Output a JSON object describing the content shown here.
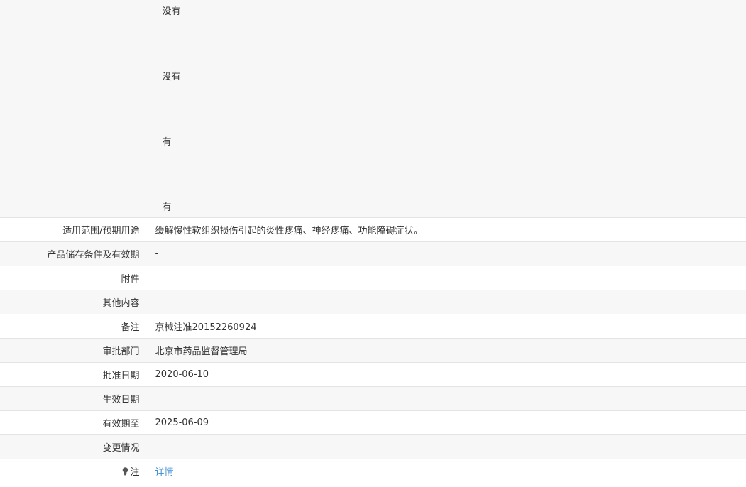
{
  "top_values": [
    "没有",
    "没有",
    "有",
    "有"
  ],
  "rows": [
    {
      "label": "适用范围/预期用途",
      "value": "缓解慢性软组织损伤引起的炎性疼痛、神经疼痛、功能障碍症状。"
    },
    {
      "label": "产品储存条件及有效期",
      "value": "-"
    },
    {
      "label": "附件",
      "value": ""
    },
    {
      "label": "其他内容",
      "value": ""
    },
    {
      "label": "备注",
      "value": "京械注准20152260924"
    },
    {
      "label": "审批部门",
      "value": "北京市药品监督管理局"
    },
    {
      "label": "批准日期",
      "value": "2020-06-10"
    },
    {
      "label": "生效日期",
      "value": ""
    },
    {
      "label": "有效期至",
      "value": "2025-06-09"
    },
    {
      "label": "变更情况",
      "value": ""
    }
  ],
  "note_row": {
    "label": "注",
    "link": "详情",
    "icon": "lightbulb-icon"
  }
}
